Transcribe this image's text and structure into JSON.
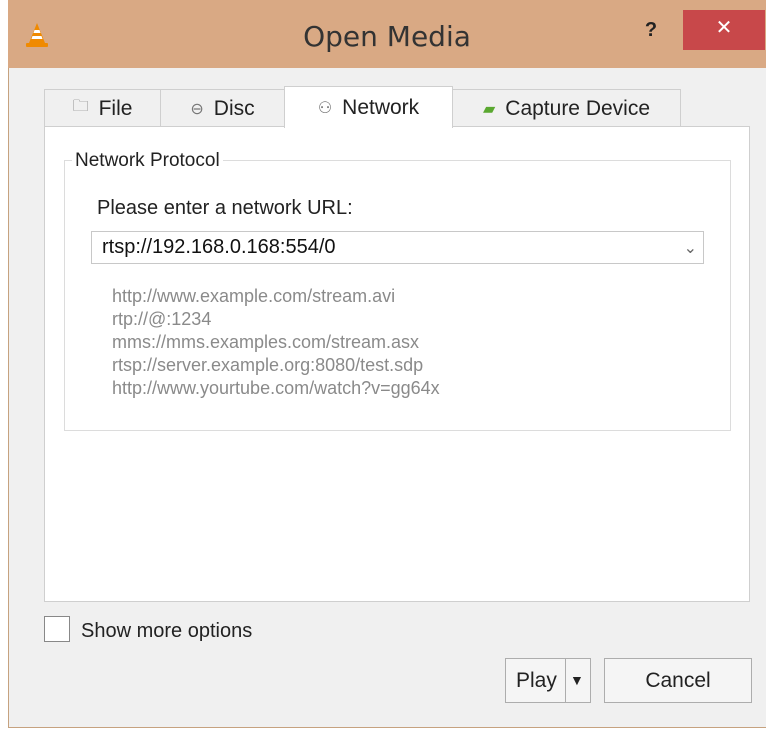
{
  "window": {
    "title": "Open Media",
    "help_label": "?",
    "close_label": "✕"
  },
  "tabs": [
    {
      "label": "File",
      "icon": "folder-icon",
      "icon_glyph": "🗀"
    },
    {
      "label": "Disc",
      "icon": "disc-icon",
      "icon_glyph": "⊖"
    },
    {
      "label": "Network",
      "icon": "network-icon",
      "icon_glyph": "⚇"
    },
    {
      "label": "Capture Device",
      "icon": "capture-card-icon",
      "icon_glyph": "▰"
    }
  ],
  "active_tab": "Network",
  "network": {
    "group_title": "Network Protocol",
    "url_label": "Please enter a network URL:",
    "url_value": "rtsp://192.168.0.168:554/0",
    "combo_arrow": "⌄",
    "examples": [
      "http://www.example.com/stream.avi",
      "rtp://@:1234",
      "mms://mms.examples.com/stream.asx",
      "rtsp://server.example.org:8080/test.sdp",
      "http://www.yourtube.com/watch?v=gg64x"
    ]
  },
  "options": {
    "show_more_label": "Show more options",
    "show_more_checked": false
  },
  "buttons": {
    "play_label": "Play",
    "play_arrow": "▼",
    "cancel_label": "Cancel"
  },
  "colors": {
    "titlebar": "#d9a984",
    "close_button": "#c8484a",
    "vlc_orange": "#f08a00"
  }
}
